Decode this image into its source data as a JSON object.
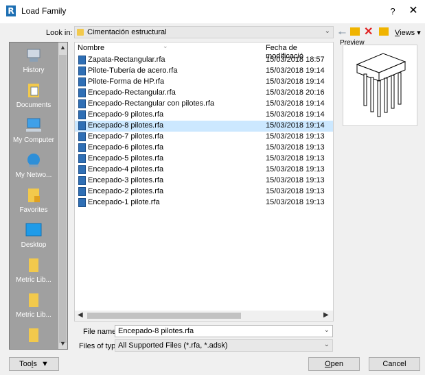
{
  "window": {
    "title": "Load Family",
    "help": "?",
    "close": "✕",
    "app_letter": "R"
  },
  "lookin": {
    "label": "Look in:",
    "value": "Cimentación estructural"
  },
  "toolbar": {
    "views_prefix": "V",
    "views_rest": "iews"
  },
  "sidebar": {
    "items": [
      {
        "label": "History",
        "icon": "history-icon"
      },
      {
        "label": "Documents",
        "icon": "documents-icon"
      },
      {
        "label": "My Computer",
        "icon": "computer-icon"
      },
      {
        "label": "My Netwo...",
        "icon": "network-icon"
      },
      {
        "label": "Favorites",
        "icon": "favorites-icon"
      },
      {
        "label": "Desktop",
        "icon": "desktop-icon"
      },
      {
        "label": "Metric Lib...",
        "icon": "folder-icon"
      },
      {
        "label": "Metric Lib...",
        "icon": "folder-icon"
      }
    ]
  },
  "filelist": {
    "columns": [
      "Nombre",
      "Fecha de modificació"
    ],
    "files": [
      {
        "name": "Zapata-Rectangular.rfa",
        "date": "15/03/2018 18:57"
      },
      {
        "name": "Pilote-Tubería de acero.rfa",
        "date": "15/03/2018 19:14"
      },
      {
        "name": "Pilote-Forma de HP.rfa",
        "date": "15/03/2018 19:14"
      },
      {
        "name": "Encepado-Rectangular.rfa",
        "date": "15/03/2018 20:16"
      },
      {
        "name": "Encepado-Rectangular con pilotes.rfa",
        "date": "15/03/2018 19:14"
      },
      {
        "name": "Encepado-9 pilotes.rfa",
        "date": "15/03/2018 19:14"
      },
      {
        "name": "Encepado-8 pilotes.rfa",
        "date": "15/03/2018 19:14"
      },
      {
        "name": "Encepado-7 pilotes.rfa",
        "date": "15/03/2018 19:13"
      },
      {
        "name": "Encepado-6 pilotes.rfa",
        "date": "15/03/2018 19:13"
      },
      {
        "name": "Encepado-5 pilotes.rfa",
        "date": "15/03/2018 19:13"
      },
      {
        "name": "Encepado-4 pilotes.rfa",
        "date": "15/03/2018 19:13"
      },
      {
        "name": "Encepado-3 pilotes.rfa",
        "date": "15/03/2018 19:13"
      },
      {
        "name": "Encepado-2 pilotes.rfa",
        "date": "15/03/2018 19:13"
      },
      {
        "name": "Encepado-1 pilote.rfa",
        "date": "15/03/2018 19:13"
      }
    ],
    "selected_index": 6
  },
  "preview": {
    "label": "Preview"
  },
  "filename": {
    "label": "File name:",
    "value": "Encepado-8 pilotes.rfa"
  },
  "filetype": {
    "label": "Files of type:",
    "value": "All Supported Files  (*.rfa, *.adsk)"
  },
  "buttons": {
    "tools_a": "Too",
    "tools_u": "l",
    "tools_b": "s",
    "open_u": "O",
    "open_rest": "pen",
    "cancel": "Cancel"
  },
  "colors": {
    "selection": "#cce8ff",
    "sidebar": "#a0a0a0",
    "accent": "#1d6fb3"
  }
}
